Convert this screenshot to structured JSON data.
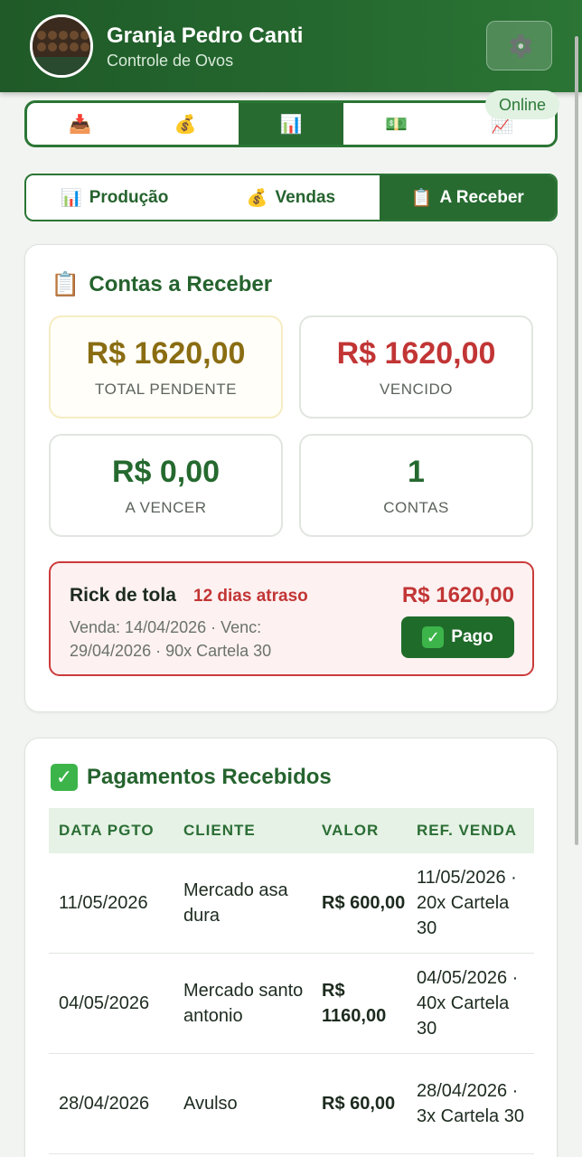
{
  "header": {
    "farm_name": "Granja Pedro Canti",
    "subtitle": "Controle de Ovos",
    "settings_icon": "gear-icon",
    "status": "Online"
  },
  "icon_nav": [
    {
      "icon": "inbox-tray-icon",
      "glyph": "📥",
      "active": false
    },
    {
      "icon": "money-bag-icon",
      "glyph": "💰",
      "active": false
    },
    {
      "icon": "bar-chart-icon",
      "glyph": "📊",
      "active": true
    },
    {
      "icon": "dollar-banknote-icon",
      "glyph": "💵",
      "active": false
    },
    {
      "icon": "trend-up-chart-icon",
      "glyph": "📈",
      "active": false
    }
  ],
  "tabs": [
    {
      "label": "Produção",
      "glyph": "📊",
      "icon": "bar-chart-icon",
      "active": false
    },
    {
      "label": "Vendas",
      "glyph": "💰",
      "icon": "money-bag-icon",
      "active": false
    },
    {
      "label": "A Receber",
      "glyph": "📋",
      "icon": "clipboard-icon",
      "active": true
    }
  ],
  "receivables": {
    "title": "Contas a Receber",
    "title_glyph": "📋",
    "stats": {
      "pending": {
        "value": "R$ 1620,00",
        "label": "TOTAL PENDENTE",
        "color": "#8a6d12"
      },
      "overdue": {
        "value": "R$ 1620,00",
        "label": "VENCIDO",
        "color": "#c23535"
      },
      "upcoming": {
        "value": "R$ 0,00",
        "label": "A VENCER",
        "color": "#25692f"
      },
      "count": {
        "value": "1",
        "label": "CONTAS",
        "color": "#25692f"
      }
    },
    "overdue_account": {
      "client": "Rick de tola",
      "late": "12 dias atraso",
      "amount": "R$ 1620,00",
      "details": "Venda: 14/04/2026 · Venc: 29/04/2026 · 90x Cartela 30",
      "pay_label": "Pago",
      "pay_glyph": "✓"
    }
  },
  "payments": {
    "title": "Pagamentos Recebidos",
    "title_glyph": "✓",
    "headers": {
      "date": "DATA PGTO",
      "client": "CLIENTE",
      "value": "VALOR",
      "ref": "REF. VENDA"
    },
    "rows": [
      {
        "date": "11/05/2026",
        "client": "Mercado asa dura",
        "value": "R$ 600,00",
        "ref": "11/05/2026 · 20x Cartela 30"
      },
      {
        "date": "04/05/2026",
        "client": "Mercado santo antonio",
        "value": "R$ 1160,00",
        "ref": "04/05/2026 · 40x Cartela 30"
      },
      {
        "date": "28/04/2026",
        "client": "Avulso",
        "value": "R$ 60,00",
        "ref": "28/04/2026 · 3x Cartela 30"
      }
    ]
  }
}
